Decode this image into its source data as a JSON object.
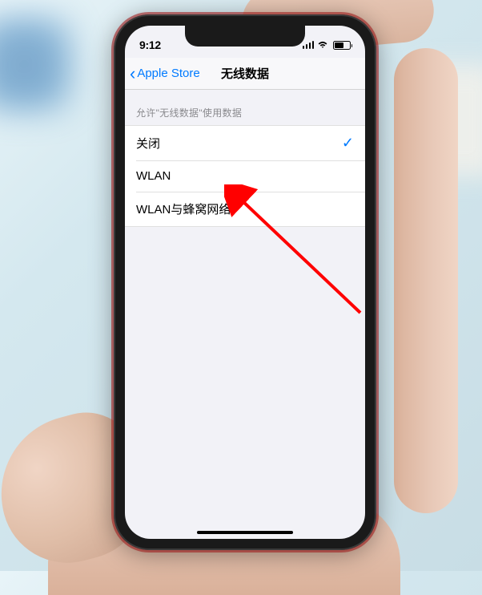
{
  "status_bar": {
    "time": "9:12"
  },
  "nav": {
    "back_label": "Apple Store",
    "title": "无线数据"
  },
  "section": {
    "header": "允许\"无线数据\"使用数据"
  },
  "options": [
    {
      "label": "关闭",
      "selected": true
    },
    {
      "label": "WLAN",
      "selected": false
    },
    {
      "label": "WLAN与蜂窝网络",
      "selected": false
    }
  ],
  "annotation": {
    "arrow_color": "#ff0000"
  }
}
